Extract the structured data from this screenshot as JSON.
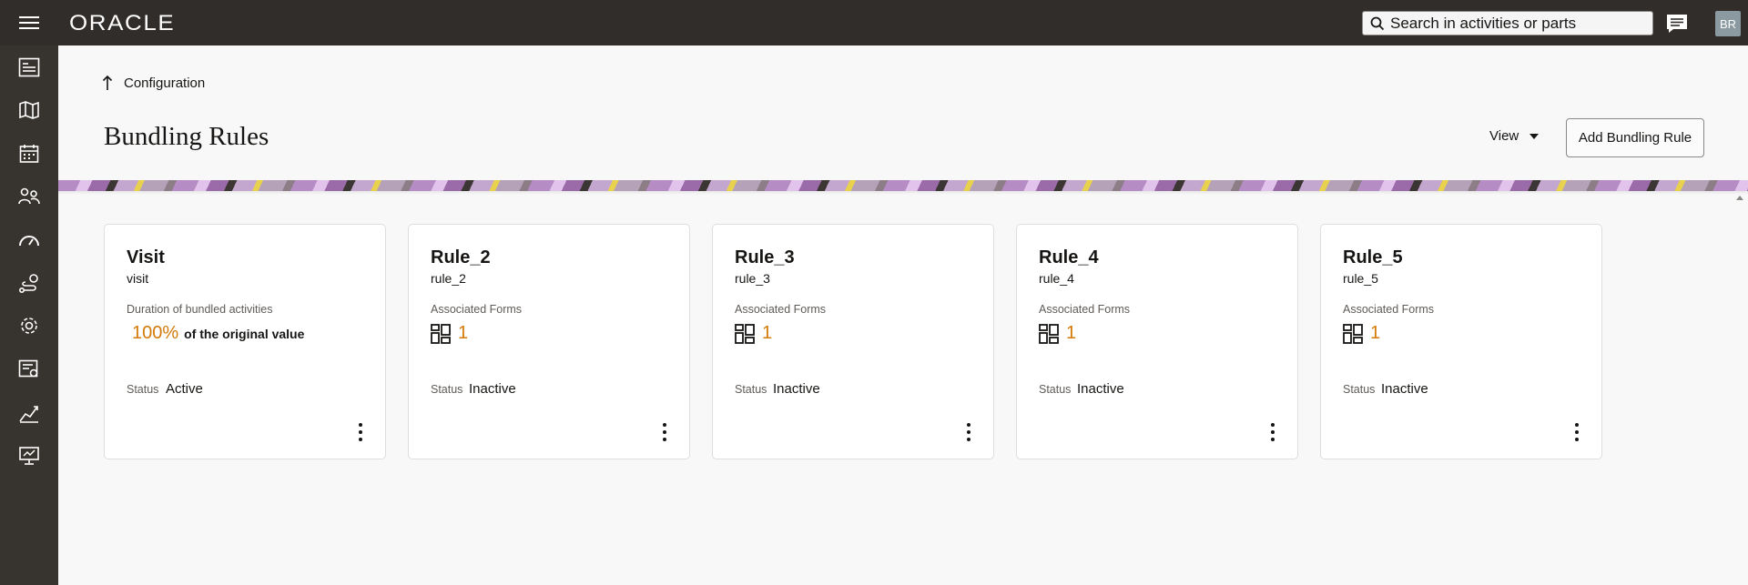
{
  "header": {
    "logo": "ORACLE",
    "search_placeholder": "Search in activities or parts",
    "avatar_initials": "BR"
  },
  "nav": {
    "icons": [
      "menu-icon",
      "activity-list-icon",
      "map-icon",
      "calendar-icon",
      "resources-icon",
      "dashboard-gauge-icon",
      "routing-icon",
      "settings-gear-icon",
      "forms-icon",
      "analytics-icon",
      "presentation-icon"
    ]
  },
  "breadcrumb": {
    "label": "Configuration"
  },
  "page": {
    "title": "Bundling Rules",
    "view_label": "View",
    "add_button": "Add Bundling Rule"
  },
  "cards": [
    {
      "title": "Visit",
      "key": "visit",
      "attr_label": "Duration of bundled activities",
      "value": "100%",
      "value_suffix": "of the original value",
      "status_label": "Status",
      "status": "Active"
    },
    {
      "title": "Rule_2",
      "key": "rule_2",
      "attr_label": "Associated Forms",
      "value": "1",
      "status_label": "Status",
      "status": "Inactive"
    },
    {
      "title": "Rule_3",
      "key": "rule_3",
      "attr_label": "Associated Forms",
      "value": "1",
      "status_label": "Status",
      "status": "Inactive"
    },
    {
      "title": "Rule_4",
      "key": "rule_4",
      "attr_label": "Associated Forms",
      "value": "1",
      "status_label": "Status",
      "status": "Inactive"
    },
    {
      "title": "Rule_5",
      "key": "rule_5",
      "attr_label": "Associated Forms",
      "value": "1",
      "status_label": "Status",
      "status": "Inactive"
    }
  ],
  "colors": {
    "topbar": "#312d2a",
    "accent_value": "#d47a08"
  }
}
